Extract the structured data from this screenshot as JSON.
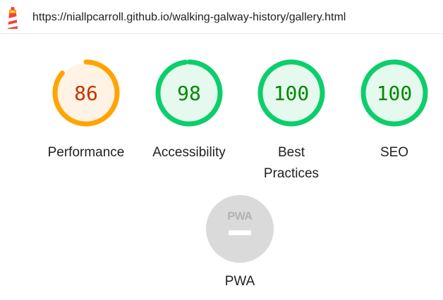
{
  "url": "https://niallpcarroll.github.io/walking-galway-history/gallery.html",
  "colors": {
    "pass": "#0cce6b",
    "pass_fill": "#e5f9ee",
    "pass_text": "#008800",
    "average": "#ffa400",
    "average_fill": "#fff3e5",
    "average_text": "#c33300",
    "pwa_gray": "#dadada",
    "pwa_badge_text": "#b2b2b2"
  },
  "gauges": [
    {
      "name": "performance",
      "score": 86,
      "score_text": "86",
      "label_lines": [
        "Performance"
      ],
      "rating": "average"
    },
    {
      "name": "accessibility",
      "score": 98,
      "score_text": "98",
      "label_lines": [
        "Accessibility"
      ],
      "rating": "pass"
    },
    {
      "name": "best-practices",
      "score": 100,
      "score_text": "100",
      "label_lines": [
        "Best",
        "Practices"
      ],
      "rating": "pass"
    },
    {
      "name": "seo",
      "score": 100,
      "score_text": "100",
      "label_lines": [
        "SEO"
      ],
      "rating": "pass"
    }
  ],
  "pwa": {
    "badge_text": "PWA",
    "label": "PWA"
  }
}
